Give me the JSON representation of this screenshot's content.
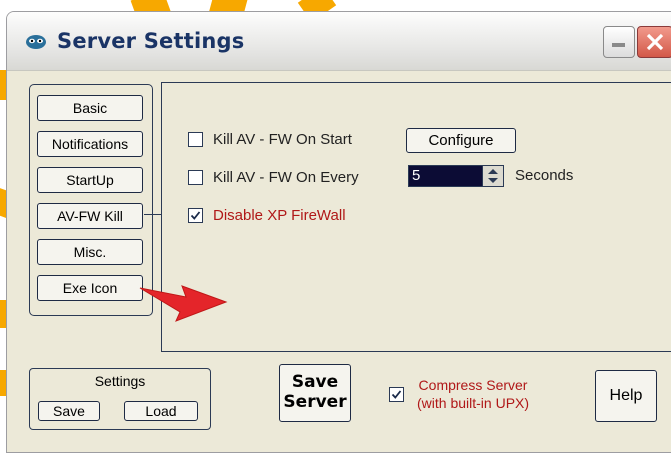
{
  "window": {
    "title": "Server Settings",
    "icon": "alien-face-icon"
  },
  "nav": {
    "items": [
      "Basic",
      "Notifications",
      "StartUp",
      "AV-FW Kill",
      "Misc.",
      "Exe Icon"
    ]
  },
  "panel": {
    "kill_on_start": {
      "label": "Kill AV - FW On Start",
      "checked": false
    },
    "configure_button": "Configure",
    "kill_every": {
      "label": "Kill AV - FW On Every",
      "checked": false,
      "value": "5",
      "unit": "Seconds"
    },
    "disable_firewall": {
      "label": "Disable XP FireWall",
      "checked": true
    }
  },
  "footer": {
    "settings_label": "Settings",
    "save_label": "Save",
    "load_label": "Load",
    "save_server_line1": "Save",
    "save_server_line2": "Server",
    "compress_line1": "Compress Server",
    "compress_line2": "(with built-in UPX)",
    "compress_checked": true,
    "help_label": "Help"
  },
  "colors": {
    "decoration": "#f7a800",
    "arrow": "#e4252a",
    "warning_text": "#b01818"
  }
}
